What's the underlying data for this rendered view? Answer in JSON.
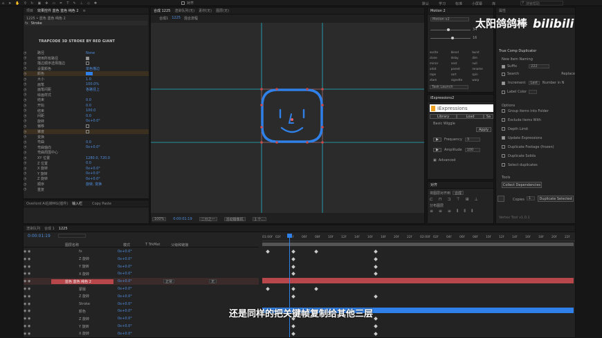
{
  "menubar": {
    "items": [
      "默认",
      "学习",
      "标准",
      "小屏幕",
      "库"
    ],
    "search_placeholder": "搜索帮助"
  },
  "watermark": {
    "text": "太阳鸽鸽棒"
  },
  "effects_panel": {
    "tabs": [
      "项目",
      "效果控件 蓝色 蓝色 纯色 2",
      "≡"
    ],
    "breadcrumb": "1225 • 蓝色 蓝色 纯色 2",
    "effect_name": "Stroke",
    "plugin_banner": "TRAPCODE 3D STROKE BY RED GIANT",
    "rows": [
      {
        "label": "路径",
        "value": "None"
      },
      {
        "label": "使用所有路径",
        "value": ""
      },
      {
        "label": "描边顺序选择描边",
        "value": ""
      },
      {
        "label": "设置颜色",
        "value": "单色描边"
      },
      {
        "label": "颜色",
        "value": ""
      },
      {
        "label": "大小",
        "value": "1.0"
      },
      {
        "label": "画笔",
        "value": "100.0%"
      },
      {
        "label": "画笔间距",
        "value": "各路径上"
      },
      {
        "label": "绘画样式",
        "value": ""
      },
      {
        "label": "结束",
        "value": "0.0"
      },
      {
        "label": "开始",
        "value": "0.0"
      },
      {
        "label": "结束",
        "value": "100.0"
      },
      {
        "label": "间距",
        "value": "0.0"
      },
      {
        "label": "旋转",
        "value": "0x+0.0°"
      },
      {
        "label": "偏移",
        "value": ""
      },
      {
        "label": "锥度",
        "value": ""
      },
      {
        "label": "变换",
        "value": ""
      },
      {
        "label": "弯曲",
        "value": "0.0"
      },
      {
        "label": "弯曲轴向",
        "value": "0x+0.0°"
      },
      {
        "label": "弯曲周围中心",
        "value": ""
      },
      {
        "label": "XY 位置",
        "value": "1280.0, 720.0"
      },
      {
        "label": "Z 位置",
        "value": "0.0"
      },
      {
        "label": "X 旋转",
        "value": "0x+0.0°"
      },
      {
        "label": "Y 旋转",
        "value": "0x+0.0°"
      },
      {
        "label": "Z 旋转",
        "value": "0x+0.0°"
      },
      {
        "label": "顺序",
        "value": "旋转, 变换"
      },
      {
        "label": "重复",
        "value": ""
      }
    ]
  },
  "bottom_left": {
    "tabs": [
      "Overlord Ai右转MG(插件)",
      "Copy Paste"
    ],
    "tab3": "输入栏"
  },
  "viewer": {
    "tabs": [
      "合成 1225",
      "渲染队列(无)",
      "素材(无)",
      "图层(无)"
    ],
    "sub_tabs": [
      "合成1",
      "1225",
      "混合流程"
    ],
    "zoom": "100%",
    "timecode": "0:00:01:19",
    "view": "二分之一",
    "camera": "活动摄像机",
    "views": "1 个..."
  },
  "motion": {
    "title": "Motion 2",
    "version": "Motion v2",
    "value1": "34",
    "value2": "16",
    "buttons": [
      "excite",
      "blend",
      "burst",
      "clone",
      "delay",
      "dim",
      "mirror",
      "nest",
      "null",
      "orbit",
      "parent",
      "rename",
      "rope",
      "sort",
      "spin",
      "stare",
      "vignette",
      "warp"
    ],
    "task_label": "Task Launch"
  },
  "iexpressions": {
    "title": "iExpressions2",
    "logo": "iExpressions",
    "tabs": [
      "Library",
      "Load",
      "Sa"
    ],
    "preset": "Basic Wiggle",
    "apply": "Apply",
    "frequency_label": "Frequency",
    "frequency": "3",
    "amplitude_label": "Amplitude",
    "amplitude": "100",
    "advanced": "Advanced"
  },
  "align": {
    "title": "对齐",
    "label": "将图层对齐到",
    "target": "合成",
    "distribute": "分布图层"
  },
  "true_comp": {
    "title": "True Comp Duplicator",
    "section_new": "New Item Naming",
    "suffix_label": "Suffix",
    "suffix_value": "222",
    "search": "Search",
    "replace": "Replace",
    "increment": "Increment",
    "last": "Last",
    "number": "Number in N",
    "label_color": "Label Color",
    "section_options": "Options",
    "options": [
      "Group items into Folder",
      "Exclude items With",
      "Depth Limit",
      "Update Expressions",
      "Duplicate Footage (frozen)",
      "Duplicate Solids",
      "Select duplicates"
    ],
    "section_tools": "Tools",
    "collect_btn": "Collect Dependencies",
    "copies_label": "Copies",
    "copies_value": "1",
    "duplicate_btn": "Duplicate Selected",
    "footer": "Vertex Tool v1.0.1"
  },
  "timeline": {
    "tabs": [
      "渲染队列",
      "合成 1",
      "1225"
    ],
    "timecode": "0:00:01:19",
    "columns": [
      "图层名称",
      "模式",
      "T TrkMat",
      "父级和链接"
    ],
    "layers": [
      {
        "name": "fx",
        "highlight": false
      },
      {
        "name": "Z 旋转",
        "highlight": false
      },
      {
        "name": "Y 旋转",
        "highlight": false
      },
      {
        "name": "X 旋转",
        "highlight": false
      },
      {
        "name": "蓝色 蓝色 纯色 2",
        "highlight": true
      },
      {
        "name": "蒙版",
        "highlight": false
      },
      {
        "name": "Z 旋转",
        "highlight": false
      },
      {
        "name": "Stroke",
        "highlight": false
      },
      {
        "name": "颜色",
        "highlight": false
      },
      {
        "name": "Z 旋转",
        "highlight": false
      },
      {
        "name": "Y 旋转",
        "highlight": false
      },
      {
        "name": "X 旋转",
        "highlight": false
      }
    ],
    "ruler": [
      "01:00f",
      "02f",
      "04f",
      "06f",
      "08f",
      "10f",
      "12f",
      "14f",
      "16f",
      "18f",
      "20f",
      "22f",
      "02:00f",
      "02f",
      "04f",
      "06f",
      "08f",
      "10f",
      "12f",
      "14f",
      "16f",
      "18f",
      "20f",
      "22f"
    ],
    "mode": "正常",
    "parent": "无"
  },
  "subtitle": "还是同样的把关键帧复制给其他三层",
  "colors": {
    "accent": "#2f80e8",
    "highlight_row": "#b8474c",
    "guide": "#1fb7c9"
  }
}
